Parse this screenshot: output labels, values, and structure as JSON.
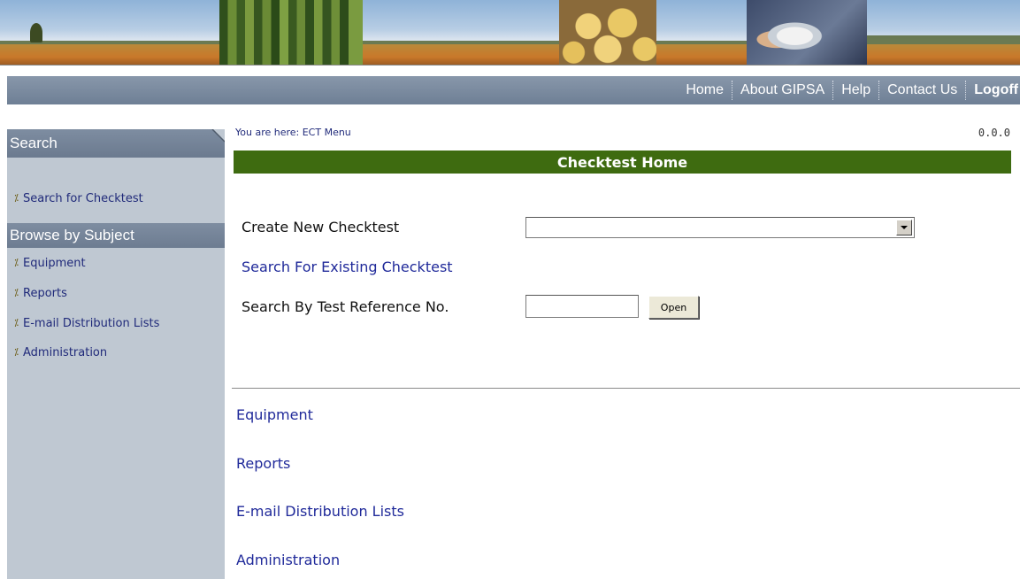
{
  "nav": {
    "items": [
      {
        "label": "Home"
      },
      {
        "label": "About GIPSA"
      },
      {
        "label": "Help"
      },
      {
        "label": "Contact Us"
      },
      {
        "label": "Logoff"
      }
    ]
  },
  "sidebar": {
    "search_header": "Search",
    "search_link": "Search for Checktest",
    "browse_header": "Browse by Subject",
    "browse_items": [
      {
        "label": "Equipment"
      },
      {
        "label": "Reports"
      },
      {
        "label": "E-mail Distribution Lists"
      },
      {
        "label": "Administration"
      }
    ]
  },
  "main": {
    "breadcrumb": "You are here: ECT Menu",
    "version": "0.0.0",
    "title": "Checktest Home",
    "create_label": "Create New Checktest",
    "create_value": "",
    "existing_link": "Search For Existing Checktest",
    "ref_label": "Search By Test Reference No.",
    "ref_value": "",
    "open_button": "Open",
    "subjects": [
      {
        "label": "Equipment"
      },
      {
        "label": "Reports"
      },
      {
        "label": "E-mail Distribution Lists"
      },
      {
        "label": "Administration"
      }
    ]
  },
  "colors": {
    "nav_bar": "#7b8aa0",
    "sidebar_bg": "#bfc8d2",
    "title_bar": "#3e6b10",
    "link": "#202a9a"
  }
}
